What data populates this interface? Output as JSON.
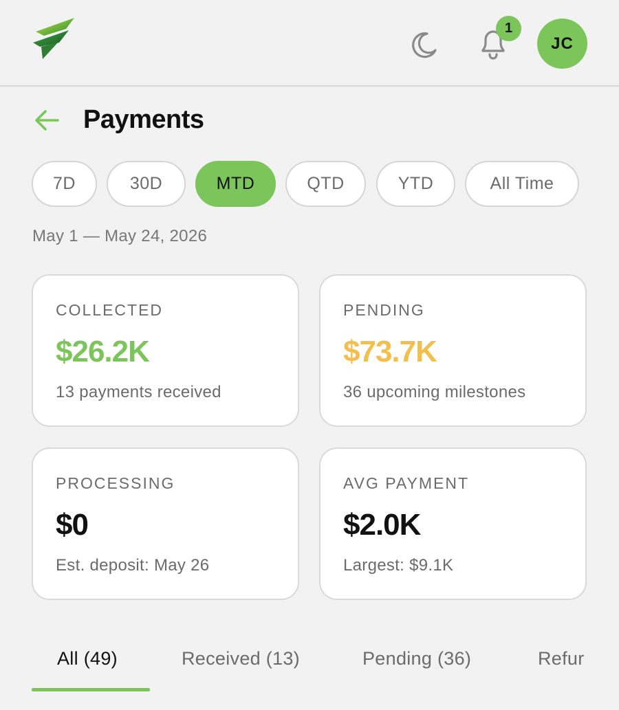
{
  "header": {
    "logo_icon": "bolt-logo-icon",
    "theme_icon": "moon-icon",
    "notification_icon": "bell-icon",
    "notification_count": "1",
    "avatar_initials": "JC"
  },
  "page": {
    "back_icon": "arrow-left-icon",
    "title": "Payments"
  },
  "range_pills": [
    {
      "label": "7D",
      "active": false
    },
    {
      "label": "30D",
      "active": false
    },
    {
      "label": "MTD",
      "active": true
    },
    {
      "label": "QTD",
      "active": false
    },
    {
      "label": "YTD",
      "active": false
    },
    {
      "label": "All Time",
      "active": false
    }
  ],
  "date_range": "May 1 — May 24, 2026",
  "stats": {
    "collected": {
      "label": "COLLECTED",
      "value": "$26.2K",
      "sub": "13 payments received",
      "color": "#7cc55a"
    },
    "pending": {
      "label": "PENDING",
      "value": "$73.7K",
      "sub": "36 upcoming milestones",
      "color": "#f2bf4c"
    },
    "processing": {
      "label": "PROCESSING",
      "value": "$0",
      "sub": "Est. deposit: May 26",
      "color": "#111111"
    },
    "avg_payment": {
      "label": "AVG PAYMENT",
      "value": "$2.0K",
      "sub": "Largest: $9.1K",
      "color": "#111111"
    }
  },
  "tabs": [
    {
      "label": "All (49)",
      "active": true
    },
    {
      "label": "Received (13)",
      "active": false
    },
    {
      "label": "Pending (36)",
      "active": false
    },
    {
      "label": "Refur",
      "active": false
    }
  ],
  "colors": {
    "accent": "#7cc55a",
    "pending": "#f2bf4c",
    "background": "#f2f2f2"
  }
}
